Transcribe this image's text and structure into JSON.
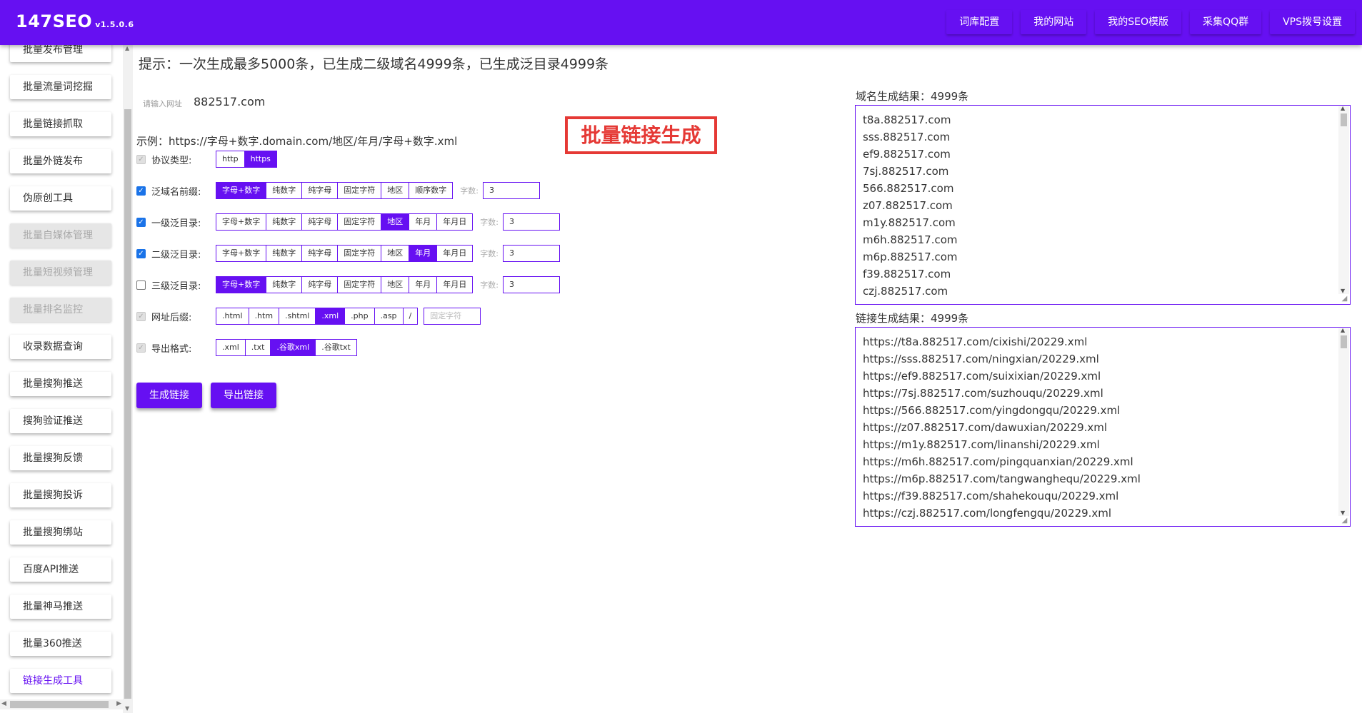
{
  "app": {
    "name": "147SEO",
    "version": "v1.5.0.6"
  },
  "topnav": [
    {
      "label": "词库配置"
    },
    {
      "label": "我的网站"
    },
    {
      "label": "我的SEO模版"
    },
    {
      "label": "采集QQ群"
    },
    {
      "label": "VPS拨号设置"
    }
  ],
  "sidebar": {
    "items": [
      {
        "label": "批量发布管理",
        "state": "normal"
      },
      {
        "label": "批量流量词挖掘",
        "state": "normal"
      },
      {
        "label": "批量链接抓取",
        "state": "normal"
      },
      {
        "label": "批量外链发布",
        "state": "normal"
      },
      {
        "label": "伪原创工具",
        "state": "normal"
      },
      {
        "label": "批量自媒体管理",
        "state": "disabled"
      },
      {
        "label": "批量短视频管理",
        "state": "disabled"
      },
      {
        "label": "批量排名监控",
        "state": "disabled"
      },
      {
        "label": "收录数据查询",
        "state": "normal"
      },
      {
        "label": "批量搜狗推送",
        "state": "normal"
      },
      {
        "label": "搜狗验证推送",
        "state": "normal"
      },
      {
        "label": "批量搜狗反馈",
        "state": "normal"
      },
      {
        "label": "批量搜狗投诉",
        "state": "normal"
      },
      {
        "label": "批量搜狗绑站",
        "state": "normal"
      },
      {
        "label": "百度API推送",
        "state": "normal"
      },
      {
        "label": "批量神马推送",
        "state": "normal"
      },
      {
        "label": "批量360推送",
        "state": "normal"
      },
      {
        "label": "链接生成工具",
        "state": "active"
      }
    ]
  },
  "main": {
    "tip": "提示：一次生成最多5000条，已生成二级域名4999条，已生成泛目录4999条",
    "url_label": "请输入网址",
    "url_value": "882517.com",
    "example": "示例：https://字母+数字.domain.com/地区/年月/字母+数字.xml",
    "stamp": "批量链接生成",
    "count_label": "字数:",
    "rows": {
      "protocol": {
        "label": "协议类型:",
        "checked": true,
        "disabled": true,
        "options": [
          "http",
          "https"
        ],
        "selected": "https"
      },
      "prefix": {
        "label": "泛域名前缀:",
        "checked": true,
        "options": [
          "字母+数字",
          "纯数字",
          "纯字母",
          "固定字符",
          "地区",
          "顺序数字"
        ],
        "selected": "字母+数字",
        "count": "3"
      },
      "dir1": {
        "label": "一级泛目录:",
        "checked": true,
        "options": [
          "字母+数字",
          "纯数字",
          "纯字母",
          "固定字符",
          "地区",
          "年月",
          "年月日"
        ],
        "selected": "地区",
        "count": "3"
      },
      "dir2": {
        "label": "二级泛目录:",
        "checked": true,
        "options": [
          "字母+数字",
          "纯数字",
          "纯字母",
          "固定字符",
          "地区",
          "年月",
          "年月日"
        ],
        "selected": "年月",
        "count": "3"
      },
      "dir3": {
        "label": "三级泛目录:",
        "checked": false,
        "options": [
          "字母+数字",
          "纯数字",
          "纯字母",
          "固定字符",
          "地区",
          "年月",
          "年月日"
        ],
        "selected": "字母+数字",
        "count": "3"
      },
      "suffix": {
        "label": "网址后缀:",
        "checked": true,
        "disabled": true,
        "options": [
          ".html",
          ".htm",
          ".shtml",
          ".xml",
          ".php",
          ".asp",
          "/"
        ],
        "selected": ".xml",
        "fixed_placeholder": "固定字符"
      },
      "export": {
        "label": "导出格式:",
        "checked": true,
        "disabled": true,
        "options": [
          ".xml",
          ".txt",
          ".谷歌xml",
          ".谷歌txt"
        ],
        "selected": ".谷歌xml"
      }
    },
    "buttons": {
      "generate": "生成链接",
      "export": "导出链接"
    },
    "domain_result": {
      "title": "域名生成结果：4999条",
      "lines": [
        "t8a.882517.com",
        "sss.882517.com",
        "ef9.882517.com",
        "7sj.882517.com",
        "566.882517.com",
        "z07.882517.com",
        "m1y.882517.com",
        "m6h.882517.com",
        "m6p.882517.com",
        "f39.882517.com",
        "czj.882517.com"
      ]
    },
    "link_result": {
      "title": "链接生成结果：4999条",
      "lines": [
        "https://t8a.882517.com/cixishi/20229.xml",
        "https://sss.882517.com/ningxian/20229.xml",
        "https://ef9.882517.com/suixixian/20229.xml",
        "https://7sj.882517.com/suzhouqu/20229.xml",
        "https://566.882517.com/yingdongqu/20229.xml",
        "https://z07.882517.com/dawuxian/20229.xml",
        "https://m1y.882517.com/linanshi/20229.xml",
        "https://m6h.882517.com/pingquanxian/20229.xml",
        "https://m6p.882517.com/tangwanghequ/20229.xml",
        "https://f39.882517.com/shahekouqu/20229.xml",
        "https://czj.882517.com/longfengqu/20229.xml"
      ]
    }
  },
  "colors": {
    "accent": "#6610f2",
    "stamp": "#e53935"
  }
}
